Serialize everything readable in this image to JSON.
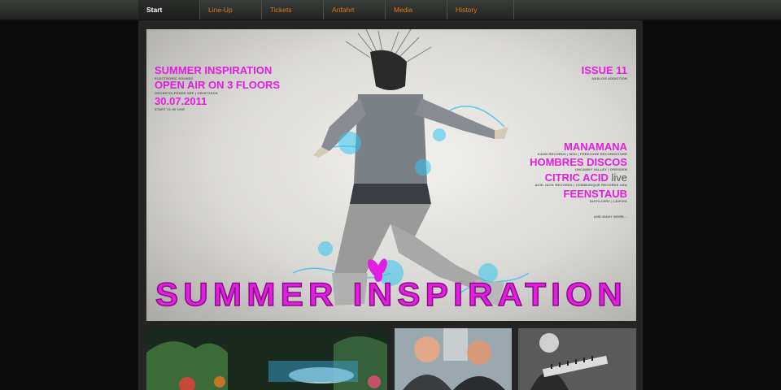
{
  "nav": {
    "items": [
      {
        "label": "Start",
        "active": true
      },
      {
        "label": "Line-Up"
      },
      {
        "label": "Tickets"
      },
      {
        "label": "Anfahrt"
      },
      {
        "label": "Media"
      },
      {
        "label": "History"
      }
    ]
  },
  "poster": {
    "event_name": "SUMMER INSPIRATION",
    "event_sub": "ELECTRONIC SOUNDZ",
    "open_air": "OPEN AIR ON 3 FLOORS",
    "location": "GROßSTOLPENER SEE | GROITZSCH",
    "date": "30.07.2011",
    "start": "START 21:00 UHR",
    "issue": "ISSUE 11",
    "issue_sub": "ANALOG ADDICTION",
    "lineup": [
      {
        "name": "MANAMANA",
        "info": "KANN RECORDS | MIDI | FREEZONE RECORDSTORE"
      },
      {
        "name": "HOMBRES DISCOS",
        "info": "UNCANNY VALLEY | DRESDEN"
      },
      {
        "name": "CITRIC ACID",
        "suffix": "live",
        "info": "ACID JACK RECORDS | COMMUNIQUE RECORDS USA"
      },
      {
        "name": "FEENSTAUB",
        "info": "DISTILLERY | LEIPZIG"
      }
    ],
    "more": "AND MANY MORE...",
    "banner_text": "SUMMER INSPIRATION"
  },
  "colors": {
    "accent": "#e21ee0",
    "nav_link": "#e07a18",
    "cyan": "#33c6f0"
  }
}
